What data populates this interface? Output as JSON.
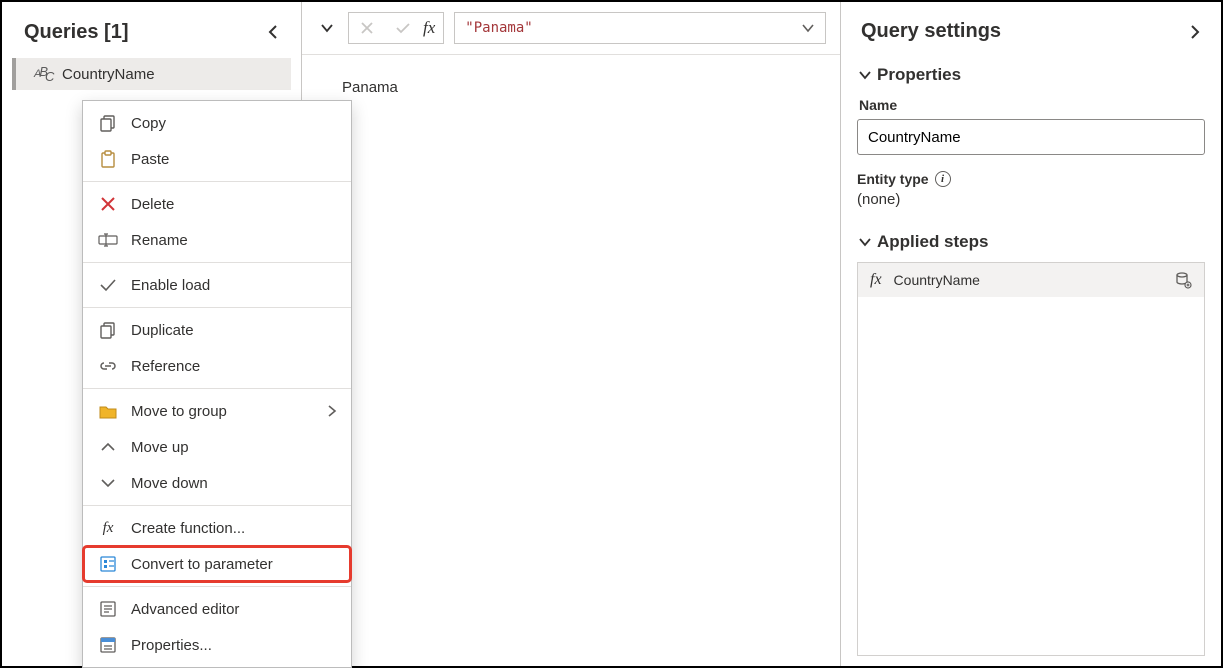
{
  "queries": {
    "title": "Queries [1]",
    "selected": "CountryName"
  },
  "context_menu": {
    "copy": "Copy",
    "paste": "Paste",
    "delete": "Delete",
    "rename": "Rename",
    "enable_load": "Enable load",
    "duplicate": "Duplicate",
    "reference": "Reference",
    "move_to_group": "Move to group",
    "move_up": "Move up",
    "move_down": "Move down",
    "create_function": "Create function...",
    "convert_param": "Convert to parameter",
    "advanced_editor": "Advanced editor",
    "properties": "Properties..."
  },
  "formula": {
    "value": "\"Panama\""
  },
  "preview": {
    "value": "Panama"
  },
  "settings": {
    "title": "Query settings",
    "properties_label": "Properties",
    "name_label": "Name",
    "name_value": "CountryName",
    "entity_label": "Entity type",
    "entity_value": "(none)",
    "applied_label": "Applied steps",
    "step0": "CountryName"
  }
}
